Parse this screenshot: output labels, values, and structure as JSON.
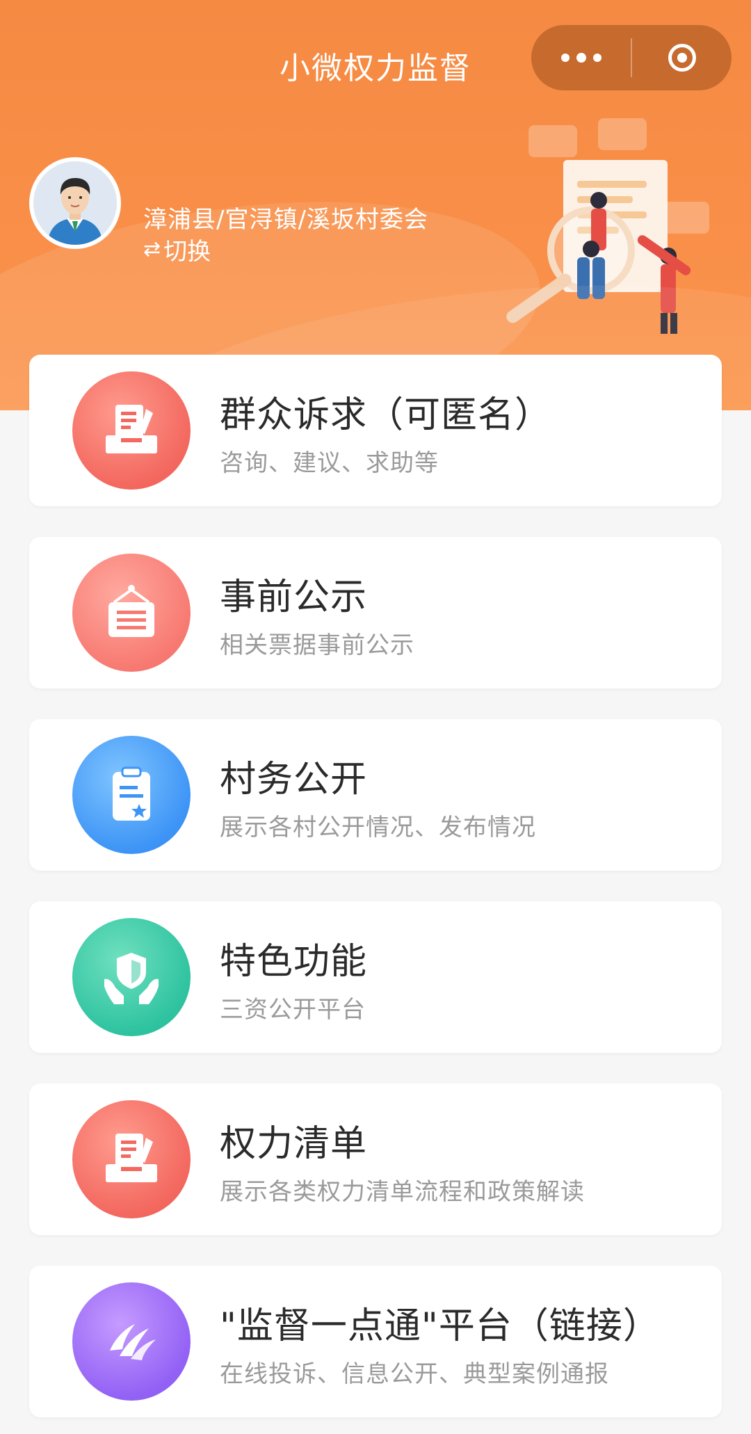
{
  "header": {
    "title": "小微权力监督",
    "location": "漳浦县/官浔镇/溪坂村委会",
    "switch_label": "切换",
    "switch_icon": "swap-arrows-icon"
  },
  "capsule": {
    "more_icon": "more-dots-icon",
    "close_icon": "target-icon"
  },
  "cards": [
    {
      "title": "群众诉求（可匿名）",
      "subtitle": "咨询、建议、求助等",
      "icon": "form-tray-icon",
      "color": "#f3685f"
    },
    {
      "title": "事前公示",
      "subtitle": "相关票据事前公示",
      "icon": "hanging-sign-icon",
      "color": "#f77a72"
    },
    {
      "title": "村务公开",
      "subtitle": "展示各村公开情况、发布情况",
      "icon": "clipboard-star-icon",
      "color": "#3e95f6"
    },
    {
      "title": "特色功能",
      "subtitle": "三资公开平台",
      "icon": "hands-shield-icon",
      "color": "#2fc3a0"
    },
    {
      "title": "权力清单",
      "subtitle": "展示各类权力清单流程和政策解读",
      "icon": "form-tray-icon",
      "color": "#f3685f"
    },
    {
      "title": "\"监督一点通\"平台（链接）",
      "subtitle": "在线投诉、信息公开、典型案例通报",
      "icon": "platform-logo-icon",
      "color": "#9362f5"
    }
  ]
}
